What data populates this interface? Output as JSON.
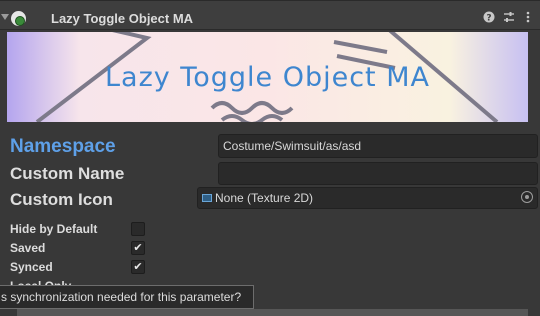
{
  "header": {
    "title": "Lazy Toggle Object MA"
  },
  "banner": {
    "text": "Lazy Toggle Object MA"
  },
  "fields": {
    "namespace_label": "Namespace",
    "namespace_value": "Costume/Swimsuit/as/asd",
    "custom_name_label": "Custom Name",
    "custom_name_value": "",
    "custom_icon_label": "Custom Icon",
    "custom_icon_value": "None (Texture 2D)"
  },
  "toggles": [
    {
      "label": "Hide by Default",
      "checked": false
    },
    {
      "label": "Saved",
      "checked": true
    },
    {
      "label": "Synced",
      "checked": true
    },
    {
      "label": "Local Only",
      "checked": false
    }
  ],
  "tooltip": {
    "text": "s synchronization needed for this parameter?"
  },
  "icons": {
    "help": "help-icon",
    "settings": "settings-icon",
    "menu": "menu-icon"
  }
}
